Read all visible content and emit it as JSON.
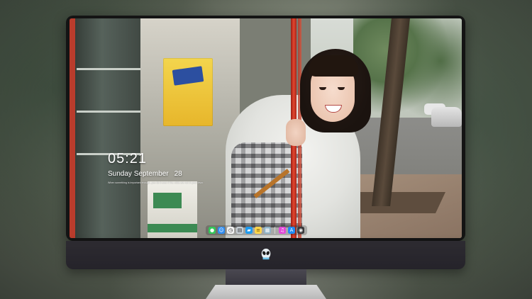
{
  "desktop": {
    "clock_time": "05:21",
    "date_weekday_month": "Sunday September",
    "date_day": "28",
    "quote_line": "When something is important enough, you do it even if the odds are not in your favor."
  },
  "dock": {
    "apps": [
      {
        "name": "messages",
        "icon": "message-icon",
        "color": "#34c759",
        "glyph": "💬"
      },
      {
        "name": "finder",
        "icon": "finder-icon",
        "color": "#2f8cf0",
        "glyph": "☺"
      },
      {
        "name": "clock",
        "icon": "clock-icon",
        "color": "#f2f2f2",
        "glyph": "◷"
      },
      {
        "name": "preview",
        "icon": "preview-icon",
        "color": "#c7cfd6",
        "glyph": "▤"
      },
      {
        "name": "claquette",
        "icon": "clapper-icon",
        "color": "#1d9bf0",
        "glyph": "▰"
      },
      {
        "name": "notes",
        "icon": "notes-icon",
        "color": "#ffd54a",
        "glyph": "≡"
      },
      {
        "name": "photos",
        "icon": "photos-icon",
        "color": "#8fb3c7",
        "glyph": "▦"
      },
      {
        "name": "itunes",
        "icon": "music-icon",
        "color": "#e24ad8",
        "glyph": "♫"
      },
      {
        "name": "app-store",
        "icon": "app-store-icon",
        "color": "#1f8bf5",
        "glyph": "A"
      },
      {
        "name": "camera",
        "icon": "camera-icon",
        "color": "#3a3a3c",
        "glyph": "◉"
      }
    ]
  },
  "monitor": {
    "logo": "alienware-logo-icon"
  }
}
